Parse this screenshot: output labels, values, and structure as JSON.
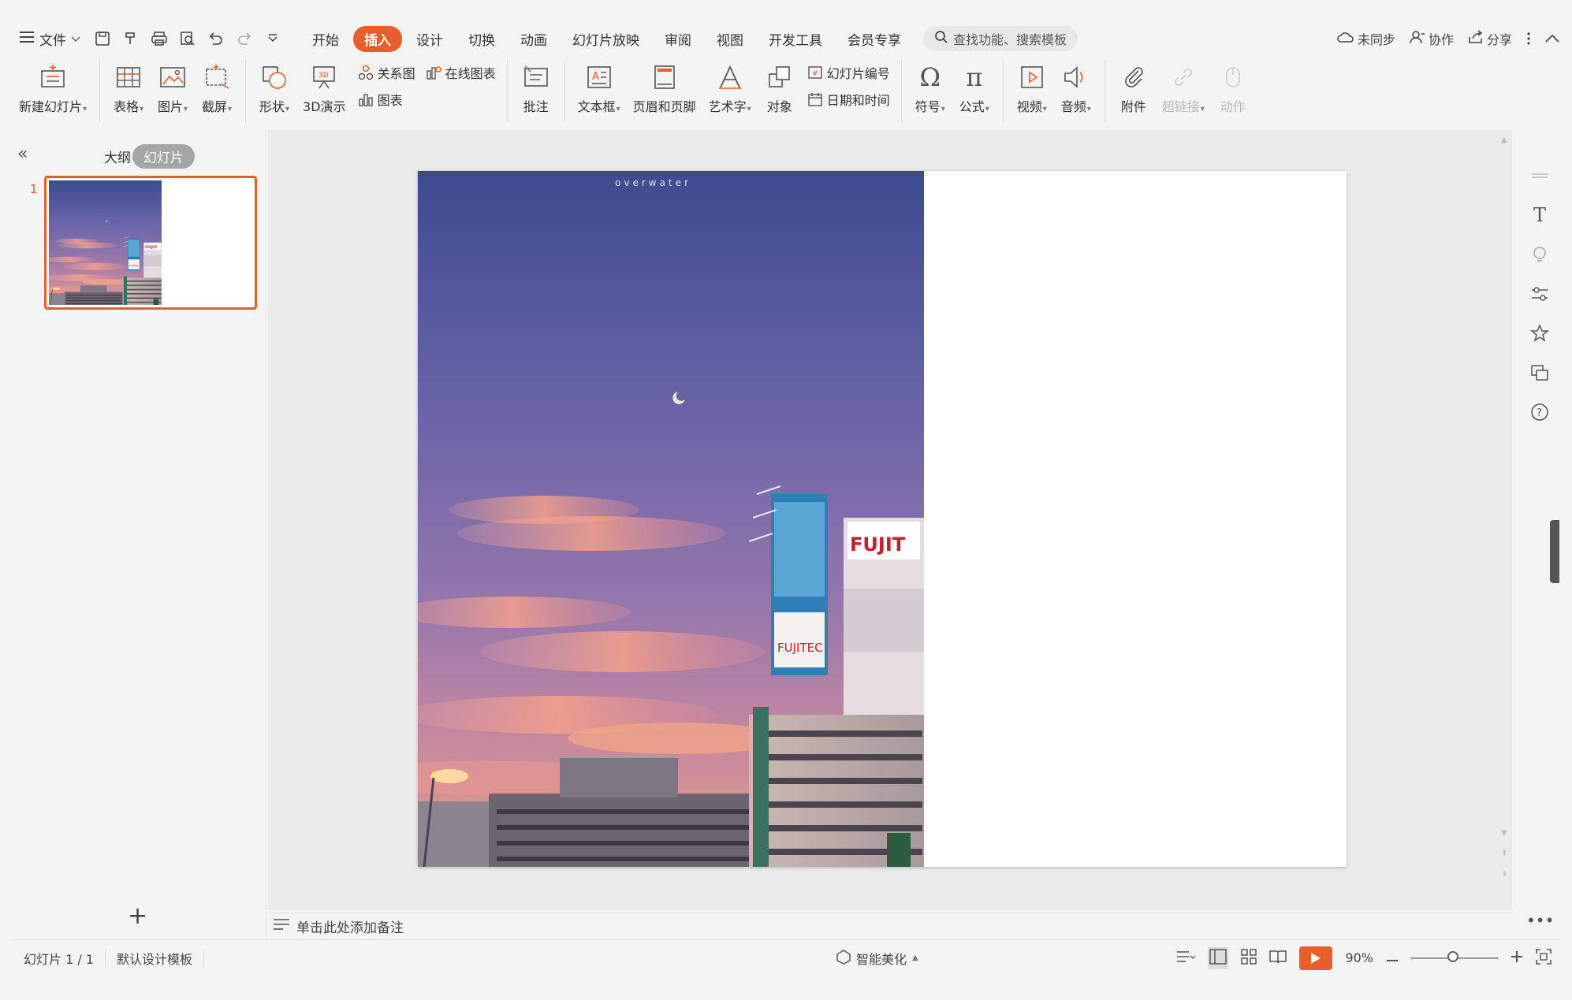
{
  "menubar": {
    "file_label": "文件",
    "tabs": [
      {
        "label": "开始"
      },
      {
        "label": "插入",
        "active": true
      },
      {
        "label": "设计"
      },
      {
        "label": "切换"
      },
      {
        "label": "动画"
      },
      {
        "label": "幻灯片放映"
      },
      {
        "label": "审阅"
      },
      {
        "label": "视图"
      },
      {
        "label": "开发工具"
      },
      {
        "label": "会员专享"
      }
    ],
    "search_placeholder": "查找功能、搜索模板",
    "sync_label": "未同步",
    "collab_label": "协作",
    "share_label": "分享"
  },
  "ribbon": {
    "new_slide": "新建幻灯片",
    "table": "表格",
    "picture": "图片",
    "screenshot": "截屏",
    "shape": "形状",
    "demo3d": "3D演示",
    "relation": "关系图",
    "online_chart": "在线图表",
    "chart": "图表",
    "comment": "批注",
    "textbox": "文本框",
    "header_footer": "页眉和页脚",
    "wordart": "艺术字",
    "object": "对象",
    "slide_number": "幻灯片编号",
    "datetime": "日期和时间",
    "symbol": "符号",
    "formula": "公式",
    "video": "视频",
    "audio": "音频",
    "attachment": "附件",
    "hyperlink": "超链接",
    "action": "动作"
  },
  "leftpanel": {
    "outline_tab": "大纲",
    "slides_tab": "幻灯片",
    "thumb_number": "1"
  },
  "slide": {
    "photo_caption": "overwater"
  },
  "notes": {
    "placeholder": "单击此处添加备注"
  },
  "statusbar": {
    "slide_count": "幻灯片 1 / 1",
    "template": "默认设计模板",
    "beautify": "智能美化",
    "zoom": "90%"
  },
  "colors": {
    "accent": "#e95e2d",
    "sky_top": "#4a5699",
    "sky_mid": "#8d73a8",
    "sunset": "#f29a7a"
  }
}
